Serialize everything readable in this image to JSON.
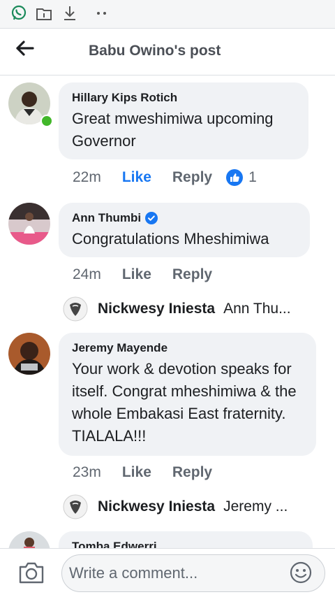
{
  "status_bar": {
    "icons": [
      "whatsapp-icon",
      "sim-card-icon",
      "download-icon",
      "more-dots-icon"
    ]
  },
  "header": {
    "title": "Babu Owino's post",
    "back_icon": "back-arrow-icon"
  },
  "comments": [
    {
      "author": "Hillary Kips Rotich",
      "text": "Great mweshimiwa upcoming Governor",
      "time": "22m",
      "like_label": "Like",
      "reply_label": "Reply",
      "reaction_count": "1",
      "liked": true,
      "online": true
    },
    {
      "author": "Ann Thumbi",
      "verified": true,
      "text": "Congratulations Mheshimiwa",
      "time": "24m",
      "like_label": "Like",
      "reply_label": "Reply",
      "reply_preview": {
        "author": "Nickwesy Iniesta",
        "text": "Ann Thu..."
      }
    },
    {
      "author": "Jeremy Mayende",
      "text": "Your work & devotion speaks for itself. Congrat mheshimiwa & the whole Embakasi East fraternity. TIALALA!!!",
      "time": "23m",
      "like_label": "Like",
      "reply_label": "Reply",
      "reply_preview": {
        "author": "Nickwesy Iniesta",
        "text": "Jeremy ..."
      }
    },
    {
      "author": "Tomba Edwerri"
    }
  ],
  "composer": {
    "placeholder": "Write a comment..."
  },
  "colors": {
    "accent": "#1877f2",
    "online": "#42b72a",
    "bubble": "#f0f2f5"
  }
}
